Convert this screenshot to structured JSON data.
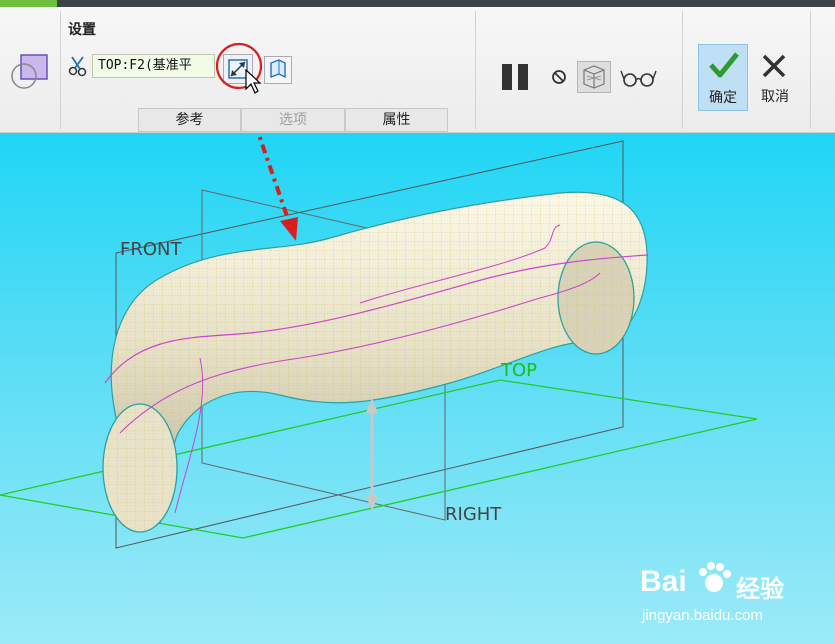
{
  "window": {
    "accent_color": "#6fbf3f"
  },
  "settings": {
    "title": "设置",
    "reference_value": "TOP:F2(基准平",
    "icons": [
      "plane-feature-icon",
      "scissors-icon",
      "flip-direction-icon",
      "sketch-view-icon"
    ]
  },
  "tabs": [
    {
      "label": "参考",
      "enabled": true
    },
    {
      "label": "选项",
      "enabled": false
    },
    {
      "label": "属性",
      "enabled": true
    }
  ],
  "controls": {
    "icons": [
      "pause-icon",
      "no-icon",
      "preview-toggle-icon",
      "glasses-icon"
    ]
  },
  "actions": {
    "confirm_label": "确定",
    "cancel_label": "取消"
  },
  "viewport": {
    "planes": {
      "front": "FRONT",
      "top": "TOP",
      "right": "RIGHT"
    },
    "colors": {
      "top_plane": "#22cc22",
      "annotation_arrow": "#d81e1e"
    }
  },
  "watermark": {
    "brand": "Bai",
    "brand_suffix": "经验",
    "url": "jingyan.baidu.com"
  }
}
